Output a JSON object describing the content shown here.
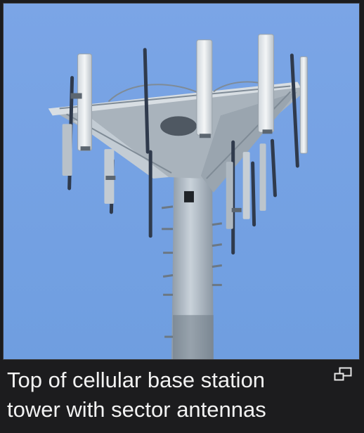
{
  "figure": {
    "caption": "Top of cellular base station tower with sector antennas",
    "enlarge_icon": "enlarge-icon",
    "sky_color": "#7aa6e4",
    "background_color": "#1c1c1e"
  }
}
